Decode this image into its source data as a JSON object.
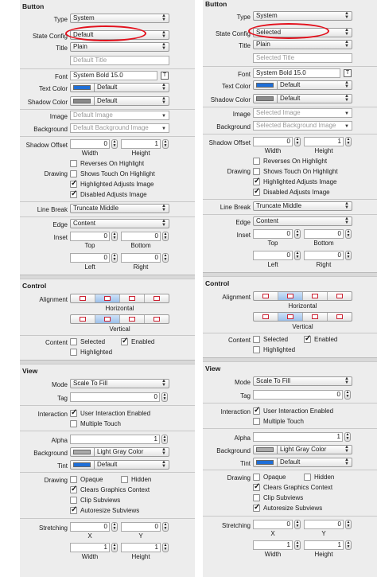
{
  "panels": [
    {
      "button": {
        "section_title": "Button",
        "type_label": "Type",
        "type_value": "System",
        "state_label": "State Config",
        "state_value": "Default",
        "title_label": "Title",
        "title_value": "Plain",
        "title_text_placeholder": "Default Title",
        "font_label": "Font",
        "font_value": "System Bold 15.0",
        "text_color_label": "Text Color",
        "text_color_value": "Default",
        "shadow_color_label": "Shadow Color",
        "shadow_color_value": "Default",
        "image_label": "Image",
        "image_placeholder": "Default Image",
        "background_label": "Background",
        "background_placeholder": "Default Background Image",
        "shadow_offset_label": "Shadow Offset",
        "shadow_w": "0",
        "shadow_h": "1",
        "width_label": "Width",
        "height_label": "Height",
        "reverses": "Reverses On Highlight",
        "drawing_label": "Drawing",
        "shows_touch": "Shows Touch On Highlight",
        "highlighted_adj": "Highlighted Adjusts Image",
        "disabled_adj": "Disabled Adjusts Image",
        "line_break_label": "Line Break",
        "line_break_value": "Truncate Middle",
        "edge_label": "Edge",
        "edge_value": "Content",
        "inset_label": "Inset",
        "inset_top": "0",
        "inset_bottom": "0",
        "inset_left": "0",
        "inset_right": "0",
        "top_label": "Top",
        "bottom_label": "Bottom",
        "left_label": "Left",
        "right_label": "Right",
        "checks": {
          "reverses": false,
          "shows_touch": false,
          "highlighted_adj": true,
          "disabled_adj": true
        }
      },
      "control": {
        "section_title": "Control",
        "alignment_label": "Alignment",
        "horizontal_label": "Horizontal",
        "vertical_label": "Vertical",
        "content_label": "Content",
        "selected_label": "Selected",
        "enabled_label": "Enabled",
        "highlighted_label": "Highlighted",
        "checks": {
          "selected": false,
          "enabled": true,
          "highlighted": false
        }
      },
      "view": {
        "section_title": "View",
        "mode_label": "Mode",
        "mode_value": "Scale To Fill",
        "tag_label": "Tag",
        "tag_value": "0",
        "interaction_label": "Interaction",
        "user_interaction": "User Interaction Enabled",
        "multiple_touch": "Multiple Touch",
        "alpha_label": "Alpha",
        "alpha_value": "1",
        "background_label": "Background",
        "background_value": "Light Gray Color",
        "tint_label": "Tint",
        "tint_value": "Default",
        "drawing_label": "Drawing",
        "opaque": "Opaque",
        "hidden": "Hidden",
        "clears": "Clears Graphics Context",
        "clip": "Clip Subviews",
        "autoresize": "Autoresize Subviews",
        "stretching_label": "Stretching",
        "stretch_x": "0",
        "stretch_y": "0",
        "stretch_w": "1",
        "stretch_h": "1",
        "x_label": "X",
        "y_label": "Y",
        "width_label": "Width",
        "height_label": "Height",
        "checks": {
          "user_interaction": true,
          "multiple_touch": false,
          "opaque": false,
          "hidden": false,
          "clears": true,
          "clip": false,
          "autoresize": true
        }
      }
    },
    {
      "button": {
        "section_title": "Button",
        "type_label": "Type",
        "type_value": "System",
        "state_label": "State Config",
        "state_value": "Selected",
        "title_label": "Title",
        "title_value": "Plain",
        "title_text_placeholder": "Selected Title",
        "font_label": "Font",
        "font_value": "System Bold 15.0",
        "text_color_label": "Text Color",
        "text_color_value": "Default",
        "shadow_color_label": "Shadow Color",
        "shadow_color_value": "Default",
        "image_label": "Image",
        "image_placeholder": "Selected Image",
        "background_label": "Background",
        "background_placeholder": "Selected Background Image",
        "shadow_offset_label": "Shadow Offset",
        "shadow_w": "0",
        "shadow_h": "1",
        "width_label": "Width",
        "height_label": "Height",
        "reverses": "Reverses On Highlight",
        "drawing_label": "Drawing",
        "shows_touch": "Shows Touch On Highlight",
        "highlighted_adj": "Highlighted Adjusts Image",
        "disabled_adj": "Disabled Adjusts Image",
        "line_break_label": "Line Break",
        "line_break_value": "Truncate Middle",
        "edge_label": "Edge",
        "edge_value": "Content",
        "inset_label": "Inset",
        "inset_top": "0",
        "inset_bottom": "0",
        "inset_left": "0",
        "inset_right": "0",
        "top_label": "Top",
        "bottom_label": "Bottom",
        "left_label": "Left",
        "right_label": "Right",
        "checks": {
          "reverses": false,
          "shows_touch": false,
          "highlighted_adj": true,
          "disabled_adj": true
        }
      },
      "control": {
        "section_title": "Control",
        "alignment_label": "Alignment",
        "horizontal_label": "Horizontal",
        "vertical_label": "Vertical",
        "content_label": "Content",
        "selected_label": "Selected",
        "enabled_label": "Enabled",
        "highlighted_label": "Highlighted",
        "checks": {
          "selected": false,
          "enabled": true,
          "highlighted": false
        }
      },
      "view": {
        "section_title": "View",
        "mode_label": "Mode",
        "mode_value": "Scale To Fill",
        "tag_label": "Tag",
        "tag_value": "0",
        "interaction_label": "Interaction",
        "user_interaction": "User Interaction Enabled",
        "multiple_touch": "Multiple Touch",
        "alpha_label": "Alpha",
        "alpha_value": "1",
        "background_label": "Background",
        "background_value": "Light Gray Color",
        "tint_label": "Tint",
        "tint_value": "Default",
        "drawing_label": "Drawing",
        "opaque": "Opaque",
        "hidden": "Hidden",
        "clears": "Clears Graphics Context",
        "clip": "Clip Subviews",
        "autoresize": "Autoresize Subviews",
        "stretching_label": "Stretching",
        "stretch_x": "0",
        "stretch_y": "0",
        "stretch_w": "1",
        "stretch_h": "1",
        "x_label": "X",
        "y_label": "Y",
        "width_label": "Width",
        "height_label": "Height",
        "checks": {
          "user_interaction": true,
          "multiple_touch": false,
          "opaque": false,
          "hidden": false,
          "clears": true,
          "clip": false,
          "autoresize": true
        }
      }
    }
  ],
  "colors": {
    "text_color_swatch": "#1e6fd9",
    "shadow_color_swatch": "#8a8a8a",
    "background_swatch": "#aaaaaa",
    "tint_swatch": "#1e6fd9",
    "highlight_oval": "#e3101c"
  }
}
